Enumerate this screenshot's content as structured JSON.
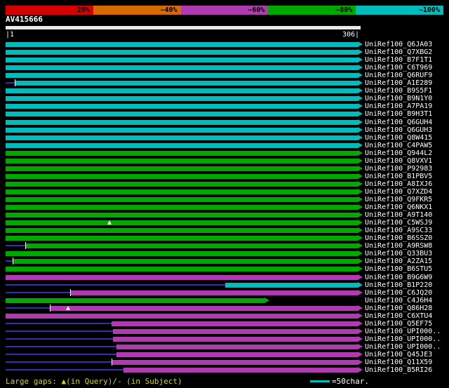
{
  "footer": {
    "gaps_note": "Large gaps: ▲(in Query)/- (in Subject)",
    "scale_note": "=50char."
  },
  "chart_data": {
    "type": "bar",
    "orientation": "horizontal",
    "title": "AV415666",
    "x_range": [
      1,
      306
    ],
    "x_unit": "residues",
    "x_start_label": "|1",
    "x_end_label": "306|",
    "legend": {
      "position": "top",
      "entries": [
        "20%",
        "~40%",
        "~60%",
        "~80%",
        "~100%"
      ],
      "colors": [
        "#d40000",
        "#d46a00",
        "#b03ab0",
        "#00a800",
        "#00bcbc"
      ]
    },
    "identity_colors": {
      "p20": "#d40000",
      "p40": "#d46a00",
      "p60": "#b03ab0",
      "p80": "#00a800",
      "p100": "#00bcbc",
      "unaligned_line": "#3030b0"
    },
    "rows": [
      {
        "label": "UniRef100_Q6JA03",
        "identity": "p100",
        "from": 1,
        "to": 306
      },
      {
        "label": "UniRef100_Q7XBG2",
        "identity": "p100",
        "from": 1,
        "to": 306
      },
      {
        "label": "UniRef100_B7F1T1",
        "identity": "p100",
        "from": 1,
        "to": 306
      },
      {
        "label": "UniRef100_C6T969",
        "identity": "p100",
        "from": 1,
        "to": 306
      },
      {
        "label": "UniRef100_Q6RUF9",
        "identity": "p100",
        "from": 1,
        "to": 306
      },
      {
        "label": "UniRef100_A1E289",
        "identity": "p100",
        "from": 9,
        "to": 306,
        "line": [
          1,
          9
        ],
        "tick": true
      },
      {
        "label": "UniRef100_B9S5F1",
        "identity": "p100",
        "from": 1,
        "to": 306
      },
      {
        "label": "UniRef100_B9N1Y0",
        "identity": "p100",
        "from": 1,
        "to": 306
      },
      {
        "label": "UniRef100_A7PA19",
        "identity": "p100",
        "from": 1,
        "to": 306
      },
      {
        "label": "UniRef100_B9H3T1",
        "identity": "p100",
        "from": 1,
        "to": 306
      },
      {
        "label": "UniRef100_Q6GUH4",
        "identity": "p100",
        "from": 1,
        "to": 306
      },
      {
        "label": "UniRef100_Q6GUH3",
        "identity": "p100",
        "from": 1,
        "to": 306
      },
      {
        "label": "UniRef100_Q8W415",
        "identity": "p100",
        "from": 1,
        "to": 306
      },
      {
        "label": "UniRef100_C4PAW5",
        "identity": "p100",
        "from": 1,
        "to": 306
      },
      {
        "label": "UniRef100_Q944L2",
        "identity": "p80",
        "from": 1,
        "to": 306
      },
      {
        "label": "UniRef100_Q8VXV1",
        "identity": "p80",
        "from": 1,
        "to": 306
      },
      {
        "label": "UniRef100_P92983",
        "identity": "p80",
        "from": 1,
        "to": 306
      },
      {
        "label": "UniRef100_B1PBV5",
        "identity": "p80",
        "from": 1,
        "to": 306
      },
      {
        "label": "UniRef100_A8IXJ6",
        "identity": "p80",
        "from": 1,
        "to": 306
      },
      {
        "label": "UniRef100_Q7XZD4",
        "identity": "p80",
        "from": 1,
        "to": 306
      },
      {
        "label": "UniRef100_Q9FKR5",
        "identity": "p80",
        "from": 1,
        "to": 306
      },
      {
        "label": "UniRef100_Q6NKX1",
        "identity": "p80",
        "from": 1,
        "to": 306
      },
      {
        "label": "UniRef100_A9T140",
        "identity": "p80",
        "from": 1,
        "to": 306
      },
      {
        "label": "UniRef100_C5WSJ9",
        "identity": "p80",
        "from": 1,
        "to": 306,
        "marker": 91
      },
      {
        "label": "UniRef100_A9SC33",
        "identity": "p80",
        "from": 1,
        "to": 306
      },
      {
        "label": "UniRef100_B6SSZ0",
        "identity": "p80",
        "from": 1,
        "to": 306
      },
      {
        "label": "UniRef100_A9RSW8",
        "identity": "p80",
        "from": 18,
        "to": 306,
        "line": [
          1,
          18
        ],
        "tick": true
      },
      {
        "label": "UniRef100_Q33BU3",
        "identity": "p80",
        "from": 1,
        "to": 306
      },
      {
        "label": "UniRef100_A2ZA15",
        "identity": "p80",
        "from": 7,
        "to": 306,
        "line": [
          1,
          7
        ],
        "tick": true
      },
      {
        "label": "UniRef100_B6STU5",
        "identity": "p80",
        "from": 1,
        "to": 306
      },
      {
        "label": "UniRef100_B9G6W9",
        "identity": "p60",
        "from": 1,
        "to": 306
      },
      {
        "label": "UniRef100_B1P220",
        "identity": "p100",
        "from": 191,
        "to": 306,
        "line": [
          1,
          191
        ]
      },
      {
        "label": "UniRef100_C6JQ20",
        "identity": "p60",
        "from": 57,
        "to": 306,
        "line": [
          1,
          57
        ],
        "tick": true
      },
      {
        "label": "UniRef100_C4J6H4",
        "identity": "p80",
        "from": 1,
        "to": 225
      },
      {
        "label": "UniRef100_Q86H28",
        "identity": "p60",
        "from": 39,
        "to": 306,
        "line": [
          1,
          39
        ],
        "tick": true,
        "marker": 55
      },
      {
        "label": "UniRef100_C6XTU4",
        "identity": "p60",
        "from": 1,
        "to": 306
      },
      {
        "label": "UniRef100_Q5EF75",
        "identity": "p60",
        "from": 93,
        "to": 306,
        "line": [
          1,
          93
        ]
      },
      {
        "label": "UniRef100_UPI000..",
        "identity": "p60",
        "from": 94,
        "to": 306,
        "line": [
          1,
          94
        ]
      },
      {
        "label": "UniRef100_UPI000..",
        "identity": "p60",
        "from": 94,
        "to": 306,
        "line": [
          1,
          94
        ]
      },
      {
        "label": "UniRef100_UPI000..",
        "identity": "p60",
        "from": 97,
        "to": 306,
        "line": [
          1,
          97
        ]
      },
      {
        "label": "UniRef100_Q45JE3",
        "identity": "p60",
        "from": 97,
        "to": 306,
        "line": [
          1,
          97
        ]
      },
      {
        "label": "UniRef100_Q11X59",
        "identity": "p60",
        "from": 93,
        "to": 306,
        "line": [
          1,
          93
        ],
        "tick": true
      },
      {
        "label": "UniRef100_B5RI26",
        "identity": "p60",
        "from": 103,
        "to": 306,
        "line": [
          1,
          103
        ]
      }
    ]
  }
}
